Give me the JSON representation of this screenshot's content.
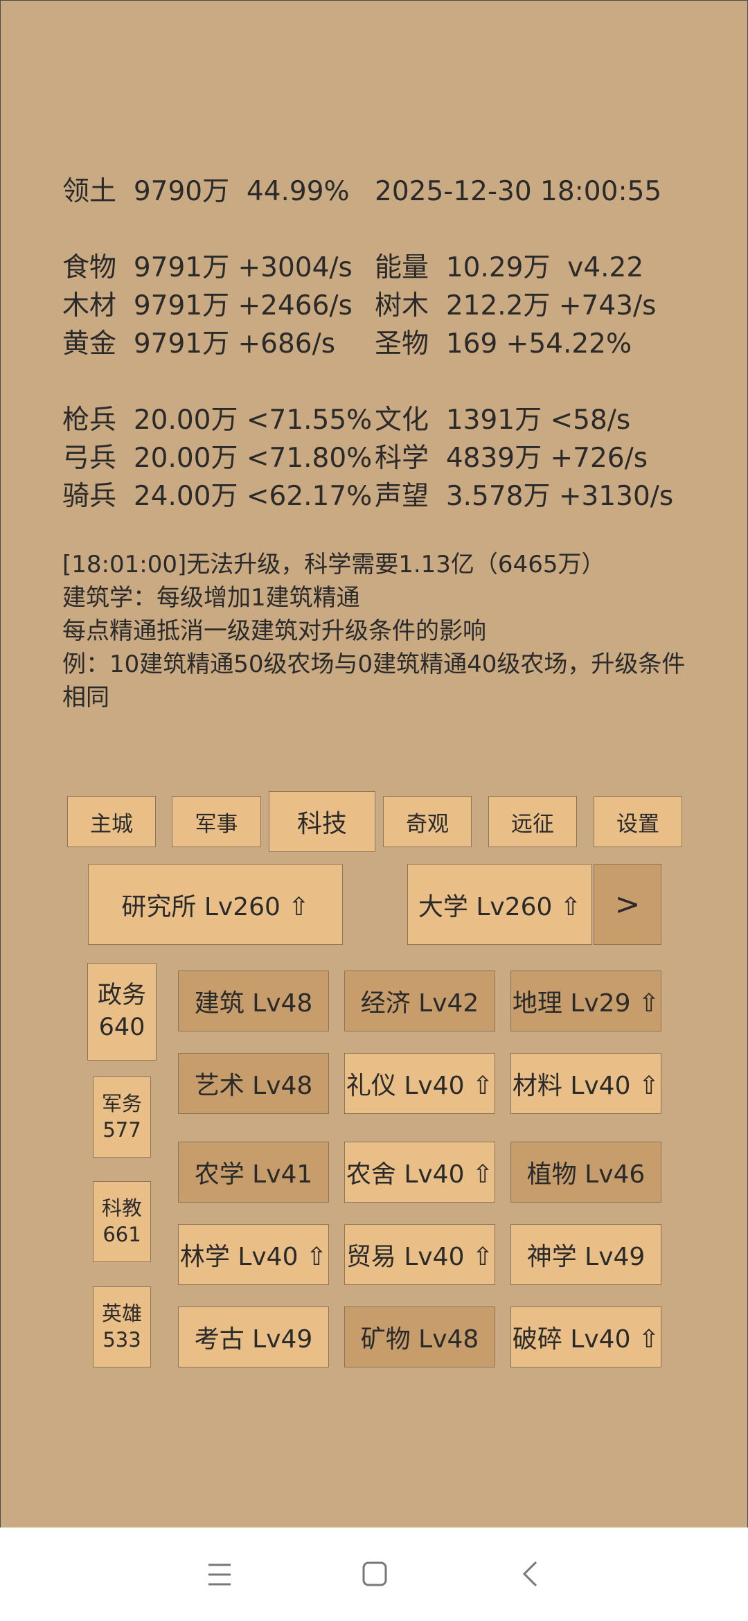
{
  "header": {
    "territory_label": "领土",
    "territory_value": "9790万",
    "territory_pct": "44.99%",
    "datetime": "2025-12-30 18:00:55"
  },
  "resources": {
    "left": [
      {
        "label": "食物",
        "value": "9791万 +3004/s"
      },
      {
        "label": "木材",
        "value": "9791万 +2466/s"
      },
      {
        "label": "黄金",
        "value": "9791万 +686/s"
      }
    ],
    "right": [
      {
        "label": "能量",
        "value": "10.29万  v4.22"
      },
      {
        "label": "树木",
        "value": "212.2万 +743/s"
      },
      {
        "label": "圣物",
        "value": "169 +54.22%"
      }
    ]
  },
  "military": {
    "left": [
      {
        "label": "枪兵",
        "value": "20.00万 <71.55%"
      },
      {
        "label": "弓兵",
        "value": "20.00万 <71.80%"
      },
      {
        "label": "骑兵",
        "value": "24.00万 <62.17%"
      }
    ],
    "right": [
      {
        "label": "文化",
        "value": "1391万 <58/s"
      },
      {
        "label": "科学",
        "value": "4839万 +726/s"
      },
      {
        "label": "声望",
        "value": "3.578万 +3130/s"
      }
    ]
  },
  "message": {
    "line1": "[18:01:00]无法升级，科学需要1.13亿（6465万）",
    "line2": "建筑学：每级增加1建筑精通",
    "line3": "每点精通抵消一级建筑对升级条件的影响",
    "line4": "例：10建筑精通50级农场与0建筑精通40级农场，升级条件相同"
  },
  "tabs": [
    "主城",
    "军事",
    "科技",
    "奇观",
    "远征",
    "设置"
  ],
  "active_tab": "科技",
  "institutes": {
    "research": "研究所 Lv260 ⇧",
    "university": "大学 Lv260 ⇧",
    "next": ">"
  },
  "categories": [
    {
      "name": "政务",
      "count": "640"
    },
    {
      "name": "军务",
      "count": "577"
    },
    {
      "name": "科教",
      "count": "661"
    },
    {
      "name": "英雄",
      "count": "533"
    }
  ],
  "techs": [
    "建筑 Lv48",
    "经济 Lv42",
    "地理 Lv29 ⇧",
    "艺术 Lv48",
    "礼仪 Lv40 ⇧",
    "材料 Lv40 ⇧",
    "农学 Lv41",
    "农舍 Lv40 ⇧",
    "植物 Lv46",
    "林学 Lv40 ⇧",
    "贸易 Lv40 ⇧",
    "神学 Lv49",
    "考古 Lv49",
    "矿物 Lv48",
    "破碎 Lv40 ⇧"
  ],
  "icons": {
    "nav_menu": "menu-icon",
    "nav_home": "home-square-icon",
    "nav_back": "back-chevron-icon"
  },
  "colors": {
    "background": "#c9aa82",
    "button_light": "#eabf87",
    "button_dark": "#c89d6c"
  }
}
